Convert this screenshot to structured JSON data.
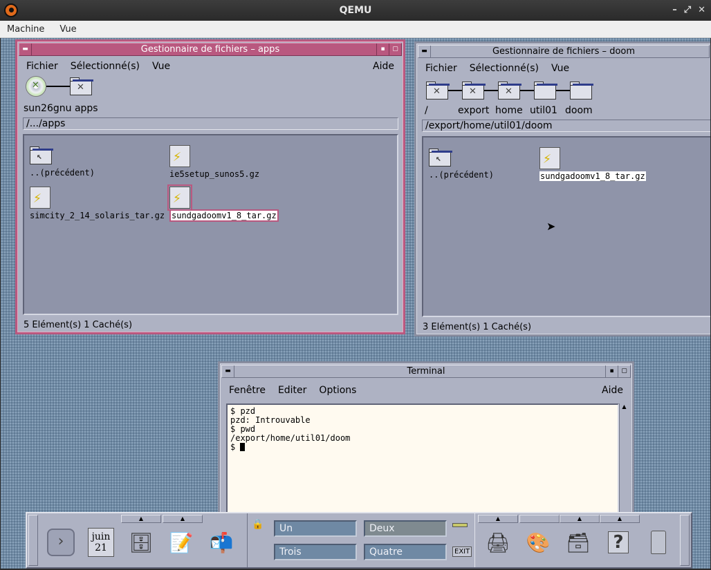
{
  "qemu": {
    "title": "QEMU",
    "menu": [
      "Machine",
      "Vue"
    ],
    "controls": [
      "–",
      "⤢",
      "✕"
    ]
  },
  "fm_apps": {
    "title": "Gestionnaire de fichiers – apps",
    "menu": {
      "file": "Fichier",
      "selected": "Sélectionné(s)",
      "view": "Vue",
      "help": "Aide"
    },
    "crumbs": "sun26gnu apps",
    "path": "/.../apps",
    "items": {
      "parent": "..(précédent)",
      "ie5": "ie5setup_sunos5.gz",
      "simcity": "simcity_2_14_solaris_tar.gz",
      "doom": "sundgadoomv1_8_tar.gz"
    },
    "status": "5 Elément(s) 1 Caché(s)"
  },
  "fm_doom": {
    "title": "Gestionnaire de fichiers – doom",
    "menu": {
      "file": "Fichier",
      "selected": "Sélectionné(s)",
      "view": "Vue"
    },
    "crumbs": [
      "/",
      "export",
      "home",
      "util01",
      "doom"
    ],
    "path": "/export/home/util01/doom",
    "items": {
      "parent": "..(précédent)",
      "doom": "sundgadoomv1_8_tar.gz"
    },
    "status": "3 Elément(s) 1 Caché(s)"
  },
  "terminal": {
    "title": "Terminal",
    "menu": {
      "window": "Fenêtre",
      "edit": "Editer",
      "options": "Options",
      "help": "Aide"
    },
    "lines": [
      "$ pzd",
      "pzd: Introuvable",
      "$ pwd",
      "/export/home/util01/doom"
    ],
    "prompt": "$ "
  },
  "panel": {
    "calendar_month": "juin",
    "calendar_day": "21",
    "workspaces": [
      "Un",
      "Deux",
      "Trois",
      "Quatre"
    ],
    "exit": "EXIT",
    "help_glyph": "?"
  },
  "colors": {
    "active_border": "#b9587f",
    "window_bg": "#aeb2c3",
    "pane_bg": "#8f94a9",
    "workspace_btn": "#6f89a4",
    "terminal_bg": "#fffaf0"
  }
}
